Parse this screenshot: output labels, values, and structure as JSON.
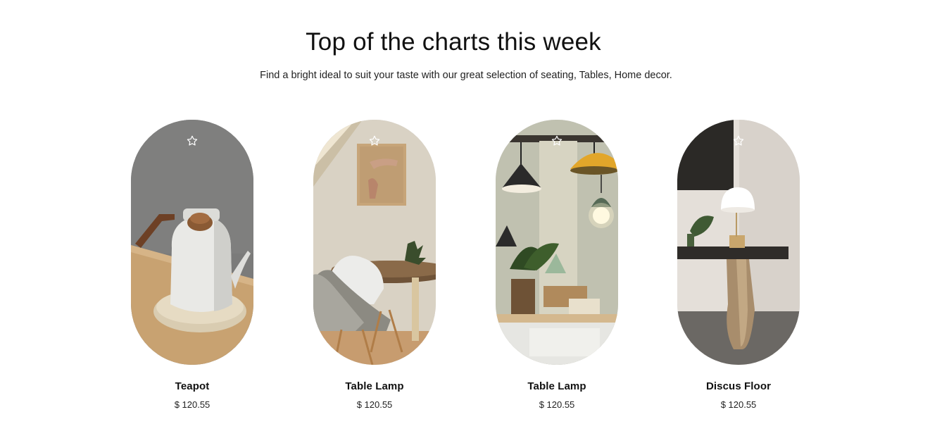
{
  "section": {
    "title": "Top of the charts this week",
    "subtitle": "Find a bright ideal to suit your taste with our great selection of seating, Tables, Home decor."
  },
  "products": [
    {
      "name": "Teapot",
      "price": "$ 120.55",
      "image": "white-enamel-teapot-photo",
      "icon": "star-icon"
    },
    {
      "name": "Table Lamp",
      "price": "$ 120.55",
      "image": "dining-table-chairs-photo",
      "icon": "star-icon"
    },
    {
      "name": "Table Lamp",
      "price": "$ 120.55",
      "image": "hanging-pendant-lamps-photo",
      "icon": "star-icon"
    },
    {
      "name": "Discus Floor",
      "price": "$ 120.55",
      "image": "discus-table-lamp-photo",
      "icon": "star-icon"
    }
  ],
  "colors": {
    "text": "#111111",
    "background": "#ffffff",
    "icon_stroke": "#ffffff"
  }
}
